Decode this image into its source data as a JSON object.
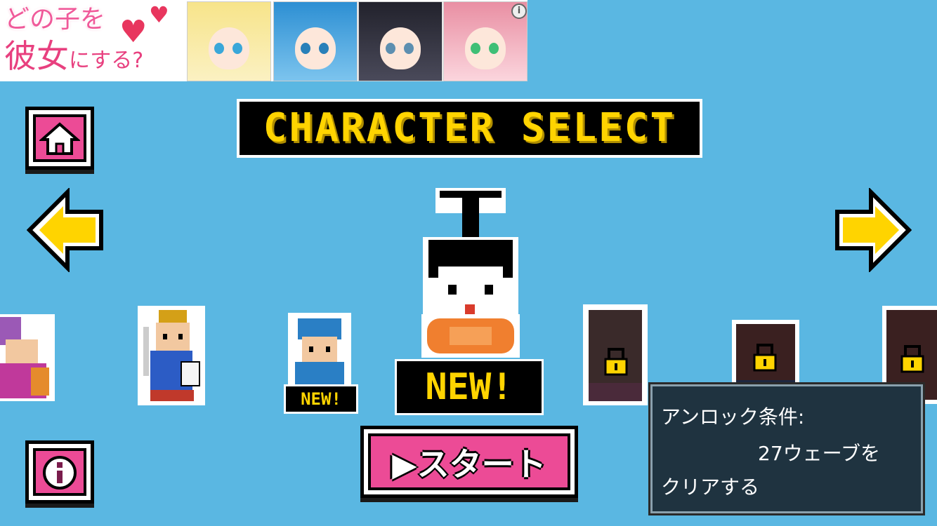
{
  "ad": {
    "line1": "どの子を",
    "line2_kanji": "彼女",
    "line2_rest": "にする?",
    "info_icon": "info-icon"
  },
  "title": "CHARACTER SELECT",
  "buttons": {
    "home_icon": "home-icon",
    "info_icon": "info-icon",
    "prev_icon": "arrow-left-icon",
    "next_icon": "arrow-right-icon",
    "start_label": "▶スタート"
  },
  "selected": {
    "new_label": "NEW!"
  },
  "characters": [
    {
      "name": "mage",
      "new": false,
      "locked": false
    },
    {
      "name": "hero",
      "new": false,
      "locked": false
    },
    {
      "name": "soldier",
      "new": true,
      "new_label": "NEW!",
      "locked": false
    },
    {
      "name": "locked-1",
      "new": false,
      "locked": true
    },
    {
      "name": "locked-2",
      "new": false,
      "locked": true
    },
    {
      "name": "locked-3",
      "new": false,
      "locked": true
    }
  ],
  "unlock": {
    "title": "アンロック条件:",
    "line2": "27ウェーブを",
    "line3": "クリアする"
  },
  "colors": {
    "background": "#5ab7e2",
    "accent_yellow": "#ffd400",
    "button_pink": "#ec4b96"
  }
}
